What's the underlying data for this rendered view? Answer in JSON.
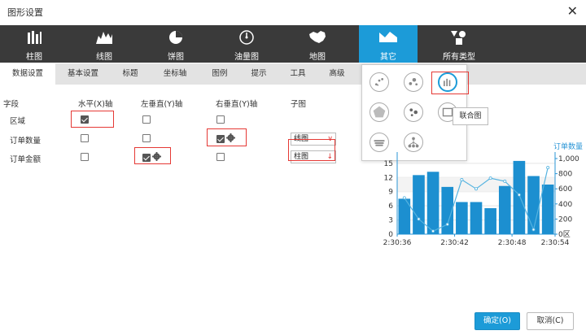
{
  "dialog": {
    "title": "图形设置",
    "close_glyph": "✕"
  },
  "types": [
    {
      "label": "柱图",
      "icon": "bar-chart-icon"
    },
    {
      "label": "线图",
      "icon": "line-chart-icon"
    },
    {
      "label": "饼图",
      "icon": "pie-chart-icon"
    },
    {
      "label": "油量图",
      "icon": "gauge-icon"
    },
    {
      "label": "地图",
      "icon": "map-icon"
    },
    {
      "label": "其它",
      "icon": "other-chart-icon",
      "active": true
    },
    {
      "label": "所有类型",
      "icon": "all-types-icon"
    }
  ],
  "tabs": [
    "数据设置",
    "基本设置",
    "标题",
    "坐标轴",
    "图例",
    "提示",
    "工具",
    "高级"
  ],
  "grid": {
    "headers": [
      "字段",
      "水平(X)轴",
      "左垂直(Y)轴",
      "右垂直(Y)轴",
      "子图"
    ],
    "rows": [
      {
        "field": "区域",
        "x": true,
        "ly": false,
        "ry": false,
        "sub": ""
      },
      {
        "field": "订单数量",
        "x": false,
        "ly": false,
        "ry": true,
        "sub": "线图"
      },
      {
        "field": "订单金额",
        "x": false,
        "ly": true,
        "ry": false,
        "sub": "柱图"
      }
    ]
  },
  "subtypes_tooltip": "联合图",
  "chart_data": {
    "type": "bar",
    "title": "",
    "right_axis_label": "订单数量",
    "categories": [
      "2:30:36",
      "",
      "",
      "",
      "2:30:42",
      "",
      "",
      "",
      "2:30:48",
      "",
      "",
      "",
      "2:30:54"
    ],
    "x_tick_labels": [
      "2:30:36",
      "2:30:42",
      "2:30:48",
      "2:30:54"
    ],
    "left_ticks": [
      "0",
      "3",
      "6",
      "9",
      "12",
      "15"
    ],
    "right_ticks": [
      "0区",
      "200",
      "400",
      "600",
      "800",
      "1,000"
    ],
    "ylim": [
      0,
      16
    ],
    "y2lim": [
      0,
      1000
    ],
    "series": [
      {
        "name": "",
        "kind": "bar",
        "values": [
          7.5,
          12.5,
          13.2,
          10.0,
          6.8,
          6.8,
          5.5,
          10.2,
          15.5,
          12.3,
          10.5
        ]
      },
      {
        "name": "",
        "kind": "line",
        "values": [
          480,
          200,
          40,
          130,
          720,
          600,
          740,
          700,
          520,
          60,
          880
        ]
      }
    ],
    "colors": {
      "bar": "#1c8fd0",
      "line": "#55b3e0",
      "axis": "#2a95d6"
    }
  },
  "buttons": {
    "ok": "确定(O)",
    "cancel": "取消(C)"
  }
}
